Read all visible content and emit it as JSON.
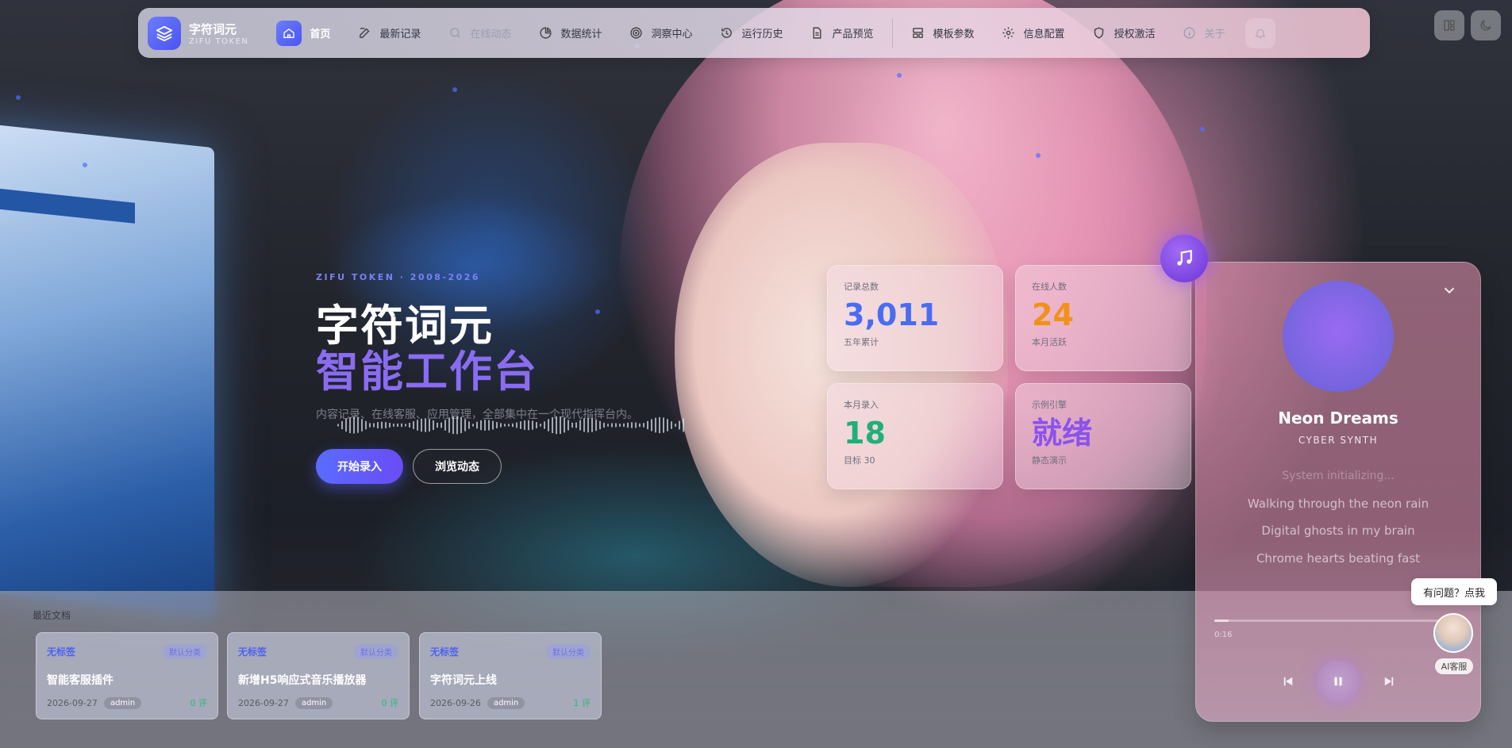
{
  "brand": {
    "name": "字符词元",
    "sub": "ZIFU TOKEN"
  },
  "nav": [
    {
      "label": "首页",
      "icon": "home-icon",
      "active": true
    },
    {
      "label": "最新记录",
      "icon": "edit-icon"
    },
    {
      "label": "在线动态",
      "icon": "search-icon",
      "faded": true
    },
    {
      "label": "数据统计",
      "icon": "pie-chart-icon"
    },
    {
      "label": "洞察中心",
      "icon": "radar-icon"
    },
    {
      "label": "运行历史",
      "icon": "history-icon"
    },
    {
      "label": "产品预览",
      "icon": "document-icon"
    },
    {
      "label": "模板参数",
      "icon": "layout-icon"
    },
    {
      "label": "信息配置",
      "icon": "gear-icon"
    },
    {
      "label": "授权激活",
      "icon": "shield-icon"
    },
    {
      "label": "关于",
      "icon": "info-icon",
      "faded": true
    }
  ],
  "hero": {
    "kicker": "ZIFU TOKEN · 2008-2026",
    "title1": "字符词元",
    "title2": "智能工作台",
    "desc": "内容记录、在线客服、应用管理，全部集中在一个现代指挥台内。",
    "btn_primary": "开始录入",
    "btn_secondary": "浏览动态"
  },
  "stats": [
    {
      "label": "记录总数",
      "value": "3,011",
      "sub": "五年累计",
      "color": "#4a6cf2"
    },
    {
      "label": "在线人数",
      "value": "24",
      "sub": "本月活跃",
      "color": "#f0921a"
    },
    {
      "label": "本月录入",
      "value": "18",
      "sub": "目标 30",
      "color": "#1fb07a"
    },
    {
      "label": "示例引擎",
      "value": "就绪",
      "sub": "静态演示",
      "color": "#8a52ee"
    }
  ],
  "player": {
    "title": "Neon Dreams",
    "artist": "CYBER SYNTH",
    "lyrics": [
      "System initializing...",
      "Walking through the neon rain",
      "Digital ghosts in my brain",
      "Chrome hearts beating fast"
    ],
    "time": "0:16",
    "progress": 0.06
  },
  "support": {
    "bubble": "有问题？点我",
    "label": "AI客服"
  },
  "recent": {
    "title": "最近文档",
    "docs": [
      {
        "tag": "无标签",
        "category": "默认分类",
        "title": "智能客服插件",
        "date": "2026-09-27",
        "author": "admin",
        "views": "0 评"
      },
      {
        "tag": "无标签",
        "category": "默认分类",
        "title": "新增H5响应式音乐播放器",
        "date": "2026-09-27",
        "author": "admin",
        "views": "0 评"
      },
      {
        "tag": "无标签",
        "category": "默认分类",
        "title": "字符词元上线",
        "date": "2026-09-26",
        "author": "admin",
        "views": "1 评"
      }
    ]
  }
}
